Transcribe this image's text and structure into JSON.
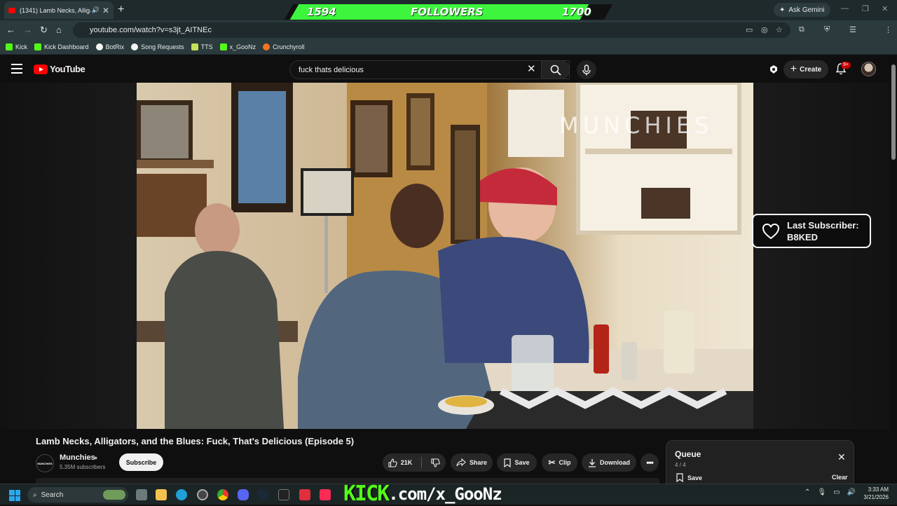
{
  "browser": {
    "tab_title": "(1341) Lamb Necks, Alligators, and the Blues",
    "url": "youtube.com/watch?v=s3jt_AITNEc",
    "ask_gemini": "Ask Gemini",
    "bookmarks": [
      {
        "label": "Kick",
        "color": "#53fc18"
      },
      {
        "label": "Kick Dashboard",
        "color": "#53fc18"
      },
      {
        "label": "BotRix",
        "color": "#f5f5f5"
      },
      {
        "label": "Song Requests",
        "color": "#f5f5f5"
      },
      {
        "label": "TTS",
        "color": "#c6e05a"
      },
      {
        "label": "x_GooNz",
        "color": "#53fc18"
      },
      {
        "label": "Crunchyroll",
        "color": "#f47521"
      }
    ]
  },
  "follower_goal": {
    "current": "1594",
    "label": "FOLLOWERS",
    "target": "1700",
    "progress": 0.94,
    "fill_color": "#3df53d"
  },
  "youtube": {
    "logo_text": "YouTube",
    "search_query": "fuck thats delicious",
    "create_label": "Create",
    "notif_badge": "9+",
    "video": {
      "watermark": "MUNCHIES",
      "title": "Lamb Necks, Alligators, and the Blues: Fuck, That's Delicious (Episode 5)"
    },
    "channel": {
      "avatar_text": "MUNCHIES",
      "name": "Munchies",
      "subscribers": "5.35M subscribers",
      "subscribe_label": "Subscribe"
    },
    "actions": {
      "likes": "21K",
      "share": "Share",
      "save": "Save",
      "clip": "Clip",
      "download": "Download"
    },
    "queue": {
      "title": "Queue",
      "count": "4 / 4",
      "save_label": "Save",
      "clear_label": "Clear"
    }
  },
  "stream_overlay": {
    "last_subscriber_label": "Last Subscriber:",
    "last_subscriber_name": "B8KED",
    "kick_prefix": "KICK",
    "kick_suffix": ".com/x_GooNz"
  },
  "taskbar": {
    "search_label": "Search",
    "time": "3:33 AM",
    "date": "3/21/2026"
  }
}
